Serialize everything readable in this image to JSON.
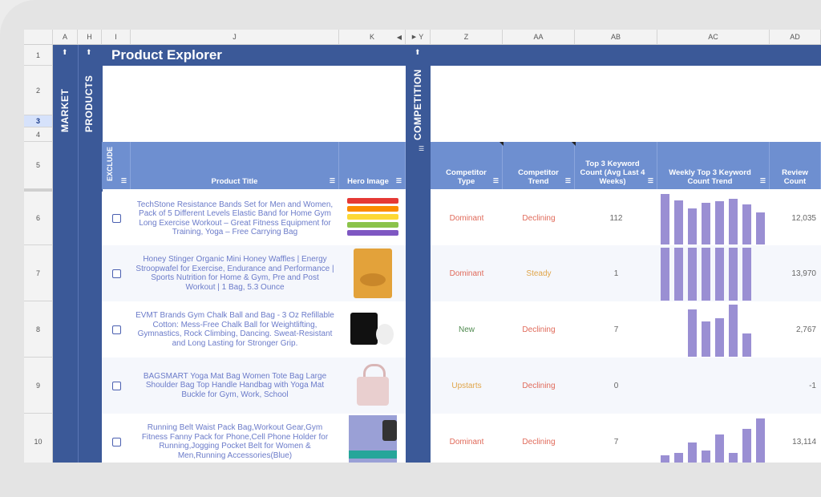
{
  "columns": [
    "A",
    "H",
    "I",
    "J",
    "K",
    "Y",
    "Z",
    "AA",
    "AB",
    "AC",
    "AD"
  ],
  "rows": [
    "1",
    "2",
    "3",
    "4",
    "5",
    "6",
    "7",
    "8",
    "9",
    "10"
  ],
  "active_row": "3",
  "bands": {
    "market": "MARKET",
    "products": "PRODUCTS",
    "competition": "COMPETITION"
  },
  "title": "Product Explorer",
  "headers": {
    "exclude": "EXCLUDE",
    "product_title": "Product Title",
    "hero_image": "Hero Image",
    "competitor_type": "Competitor Type",
    "competitor_trend": "Competitor Trend",
    "keyword_count": "Top 3 Keyword Count (Avg Last 4 Weeks)",
    "weekly_trend": "Weekly Top 3 Keyword Count Trend",
    "review_count": "Review Count"
  },
  "colors": {
    "dominant": "#e06a5a",
    "declining": "#e06a5a",
    "steady": "#e0a54a",
    "new": "#4f8a4f",
    "upstarts": "#e0a54a",
    "bar": "#9a8fd3",
    "band": "#3b5998",
    "header": "#6e8fd0"
  },
  "products": [
    {
      "title": "TechStone Resistance Bands Set for Men and Women, Pack of 5 Different Levels Elastic Band for Home Gym Long Exercise Workout – Great Fitness Equipment for Training, Yoga – Free Carrying Bag",
      "image": "resistance-bands-image",
      "type": "Dominant",
      "type_color": "#e06a5a",
      "trend": "Declining",
      "trend_color": "#e06a5a",
      "keyword_count": "112",
      "review_count": "12,035",
      "bars": [
        1.0,
        0.88,
        0.72,
        0.82,
        0.86,
        0.9,
        0.8,
        0.64
      ]
    },
    {
      "title": "Honey Stinger Organic Mini Honey Waffles | Energy Stroopwafel for Exercise, Endurance and Performance | Sports Nutrition for Home & Gym, Pre and Post Workout | 1 Bag, 5.3 Ounce",
      "image": "honey-waffles-image",
      "type": "Dominant",
      "type_color": "#e06a5a",
      "trend": "Steady",
      "trend_color": "#e0a54a",
      "keyword_count": "1",
      "review_count": "13,970",
      "bars": [
        1.0,
        1.0,
        1.0,
        1.0,
        1.0,
        1.0,
        1.0,
        0
      ]
    },
    {
      "title": "EVMT Brands Gym Chalk Ball and Bag - 3 Oz Refillable Cotton: Mess-Free Chalk Ball for Weightlifting, Gymnastics, Rock Climbing, Dancing. Sweat-Resistant and Long Lasting for Stronger Grip.",
      "image": "chalk-bag-image",
      "type": "New",
      "type_color": "#4f8a4f",
      "trend": "Declining",
      "trend_color": "#e06a5a",
      "keyword_count": "7",
      "review_count": "2,767",
      "bars": [
        0,
        0,
        0.9,
        0.66,
        0.72,
        0.98,
        0.44,
        0
      ]
    },
    {
      "title": "BAGSMART Yoga Mat Bag Women Tote Bag Large Shoulder Bag Top Handle Handbag with Yoga Mat Buckle for Gym, Work, School",
      "image": "tote-bag-image",
      "type": "Upstarts",
      "type_color": "#e0a54a",
      "trend": "Declining",
      "trend_color": "#e06a5a",
      "keyword_count": "0",
      "review_count": "-1",
      "bars": [
        0,
        0,
        0,
        0,
        0,
        0,
        0,
        0
      ]
    },
    {
      "title": "Running Belt Waist Pack Bag,Workout Gear,Gym Fitness Fanny Pack for Phone,Cell Phone Holder for Running,Jogging Pocket Belt for Women & Men,Running Accessories(Blue)",
      "image": "running-belt-image",
      "type": "Dominant",
      "type_color": "#e06a5a",
      "trend": "Declining",
      "trend_color": "#e06a5a",
      "keyword_count": "7",
      "review_count": "13,114",
      "bars": [
        0.25,
        0.3,
        0.5,
        0.35,
        0.65,
        0.3,
        0.75,
        0.95
      ]
    }
  ]
}
